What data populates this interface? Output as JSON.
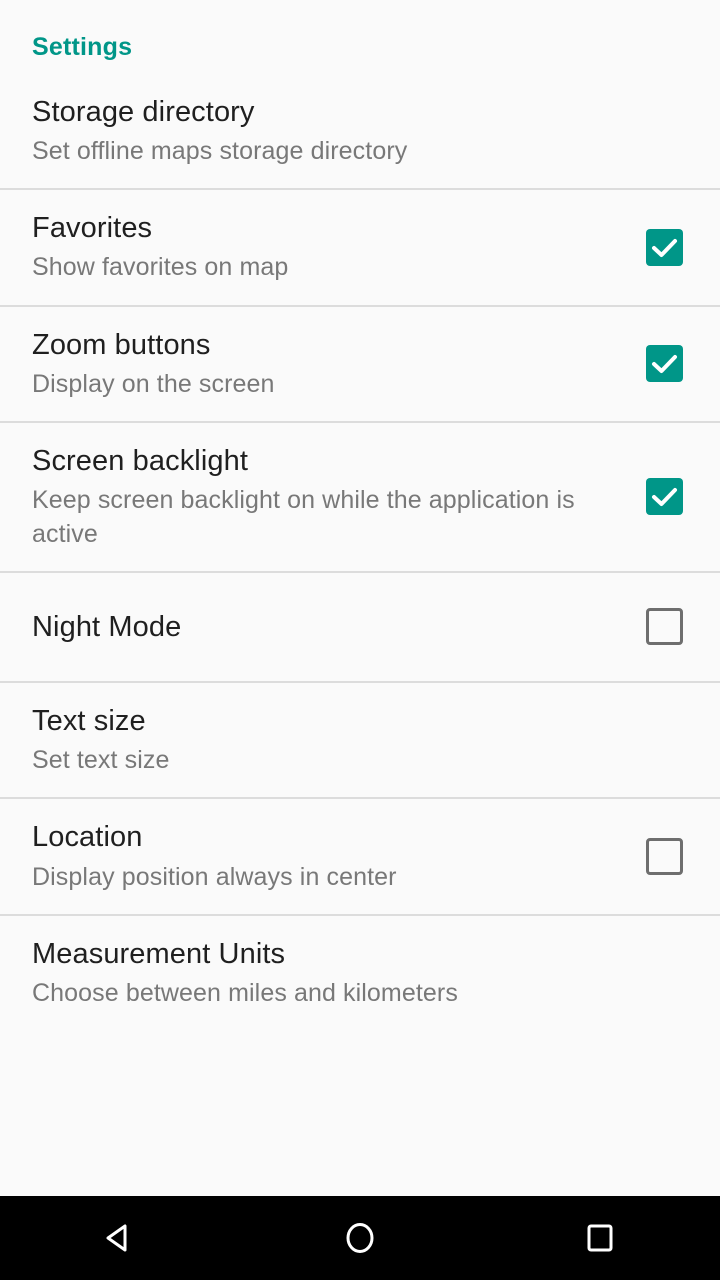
{
  "screen": {
    "background_color": "#fafafa",
    "accent_color": "#009688",
    "title_color": "#1f1f1f",
    "summary_color": "#787878",
    "divider_color": "#dcdcdc"
  },
  "section": {
    "header": "Settings"
  },
  "preferences": [
    {
      "title": "Storage directory",
      "summary": "Set offline maps storage directory",
      "control": "none",
      "checked": null
    },
    {
      "title": "Favorites",
      "summary": "Show favorites on map",
      "control": "checkbox",
      "checked": true
    },
    {
      "title": "Zoom buttons",
      "summary": "Display on the screen",
      "control": "checkbox",
      "checked": true
    },
    {
      "title": "Screen backlight",
      "summary": "Keep screen backlight on while the application is active",
      "control": "checkbox",
      "checked": true
    },
    {
      "title": "Night Mode",
      "summary": "",
      "control": "checkbox",
      "checked": false
    },
    {
      "title": "Text size",
      "summary": "Set text size",
      "control": "none",
      "checked": null
    },
    {
      "title": "Location",
      "summary": "Display position always in center",
      "control": "checkbox",
      "checked": false
    },
    {
      "title": "Measurement Units",
      "summary": "Choose between miles and kilometers",
      "control": "none",
      "checked": null
    }
  ],
  "navigation_bar": {
    "background_color": "#000000",
    "buttons": [
      {
        "name": "back-icon",
        "label": "Back"
      },
      {
        "name": "home-icon",
        "label": "Home"
      },
      {
        "name": "recents-icon",
        "label": "Recent apps"
      }
    ]
  }
}
